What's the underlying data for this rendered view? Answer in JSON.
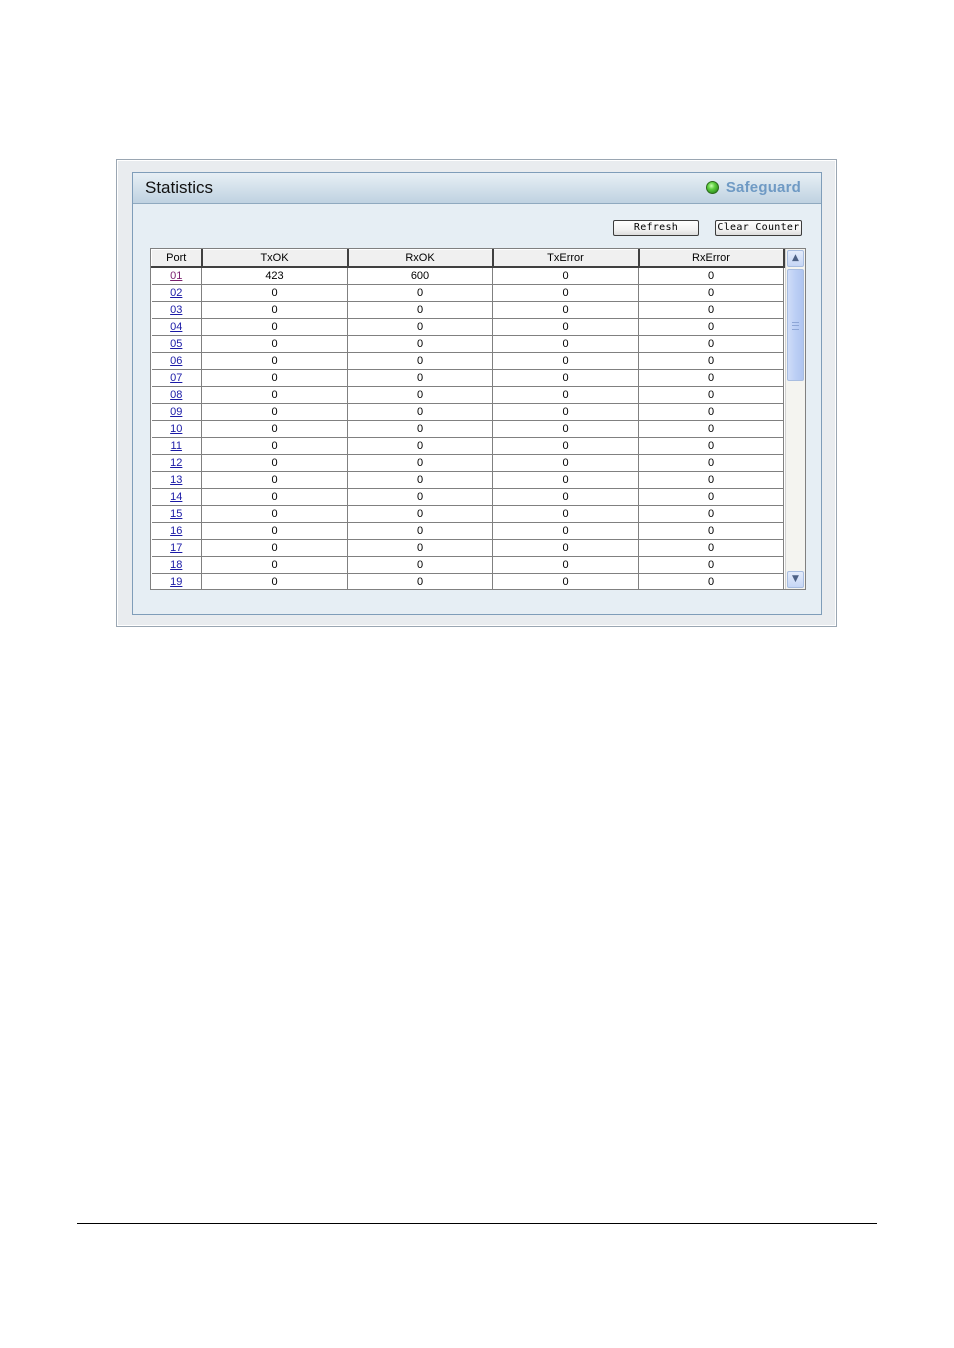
{
  "panel": {
    "title": "Statistics",
    "badge": "Safeguard",
    "badge_color": "#6f9ac4",
    "led_color": "#5fd040"
  },
  "toolbar": {
    "refresh_label": "Refresh",
    "clear_label": "Clear Counter"
  },
  "table": {
    "columns": [
      "Port",
      "TxOK",
      "RxOK",
      "TxError",
      "RxError"
    ],
    "rows": [
      {
        "port": "01",
        "txok": "423",
        "rxok": "600",
        "txerr": "0",
        "rxerr": "0"
      },
      {
        "port": "02",
        "txok": "0",
        "rxok": "0",
        "txerr": "0",
        "rxerr": "0"
      },
      {
        "port": "03",
        "txok": "0",
        "rxok": "0",
        "txerr": "0",
        "rxerr": "0"
      },
      {
        "port": "04",
        "txok": "0",
        "rxok": "0",
        "txerr": "0",
        "rxerr": "0"
      },
      {
        "port": "05",
        "txok": "0",
        "rxok": "0",
        "txerr": "0",
        "rxerr": "0"
      },
      {
        "port": "06",
        "txok": "0",
        "rxok": "0",
        "txerr": "0",
        "rxerr": "0"
      },
      {
        "port": "07",
        "txok": "0",
        "rxok": "0",
        "txerr": "0",
        "rxerr": "0"
      },
      {
        "port": "08",
        "txok": "0",
        "rxok": "0",
        "txerr": "0",
        "rxerr": "0"
      },
      {
        "port": "09",
        "txok": "0",
        "rxok": "0",
        "txerr": "0",
        "rxerr": "0"
      },
      {
        "port": "10",
        "txok": "0",
        "rxok": "0",
        "txerr": "0",
        "rxerr": "0"
      },
      {
        "port": "11",
        "txok": "0",
        "rxok": "0",
        "txerr": "0",
        "rxerr": "0"
      },
      {
        "port": "12",
        "txok": "0",
        "rxok": "0",
        "txerr": "0",
        "rxerr": "0"
      },
      {
        "port": "13",
        "txok": "0",
        "rxok": "0",
        "txerr": "0",
        "rxerr": "0"
      },
      {
        "port": "14",
        "txok": "0",
        "rxok": "0",
        "txerr": "0",
        "rxerr": "0"
      },
      {
        "port": "15",
        "txok": "0",
        "rxok": "0",
        "txerr": "0",
        "rxerr": "0"
      },
      {
        "port": "16",
        "txok": "0",
        "rxok": "0",
        "txerr": "0",
        "rxerr": "0"
      },
      {
        "port": "17",
        "txok": "0",
        "rxok": "0",
        "txerr": "0",
        "rxerr": "0"
      },
      {
        "port": "18",
        "txok": "0",
        "rxok": "0",
        "txerr": "0",
        "rxerr": "0"
      },
      {
        "port": "19",
        "txok": "0",
        "rxok": "0",
        "txerr": "0",
        "rxerr": "0"
      }
    ]
  },
  "icons": {
    "scroll_up": "▲",
    "scroll_down": "▼"
  }
}
